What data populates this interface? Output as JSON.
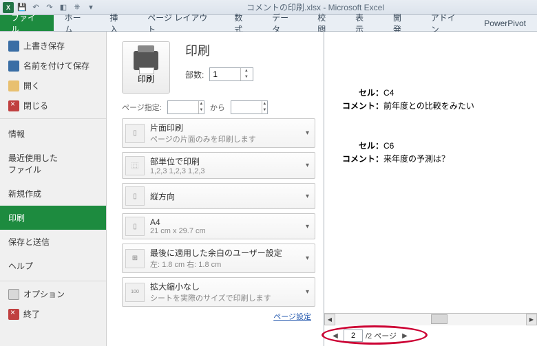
{
  "titlebar": {
    "title": "コメントの印刷.xlsx - Microsoft Excel"
  },
  "ribbon": {
    "tabs": [
      "ファイル",
      "ホーム",
      "挿入",
      "ページ レイアウト",
      "数式",
      "データ",
      "校閲",
      "表示",
      "開発",
      "アドイン",
      "PowerPivot"
    ]
  },
  "sidebar": {
    "save": "上書き保存",
    "saveas": "名前を付けて保存",
    "open": "開く",
    "close": "閉じる",
    "info": "情報",
    "recent": "最近使用した\nファイル",
    "new": "新規作成",
    "print": "印刷",
    "send": "保存と送信",
    "help": "ヘルプ",
    "options": "オプション",
    "exit": "終了"
  },
  "print": {
    "title": "印刷",
    "button": "印刷",
    "copies_label": "部数:",
    "copies_value": "1",
    "pages_label": "ページ指定:",
    "pages_to": "から",
    "opt1": {
      "t": "片面印刷",
      "d": "ページの片面のみを印刷します"
    },
    "opt2": {
      "t": "部単位で印刷",
      "d": "1,2,3   1,2,3   1,2,3"
    },
    "opt3": {
      "t": "縦方向",
      "d": ""
    },
    "opt4": {
      "t": "A4",
      "d": "21 cm x 29.7 cm"
    },
    "opt5": {
      "t": "最後に適用した余白のユーザー設定",
      "d": "左: 1.8 cm   右: 1.8 cm"
    },
    "opt6": {
      "t": "拡大縮小なし",
      "d": "シートを実際のサイズで印刷します"
    },
    "page_setup": "ページ設定"
  },
  "preview": {
    "cell_label": "セル：",
    "comment_label": "コメント：",
    "c1_cell": "C4",
    "c1_text": "前年度との比較をみたい",
    "c2_cell": "C6",
    "c2_text": "来年度の予測は？",
    "page_current": "2",
    "page_total": "/2 ページ"
  }
}
